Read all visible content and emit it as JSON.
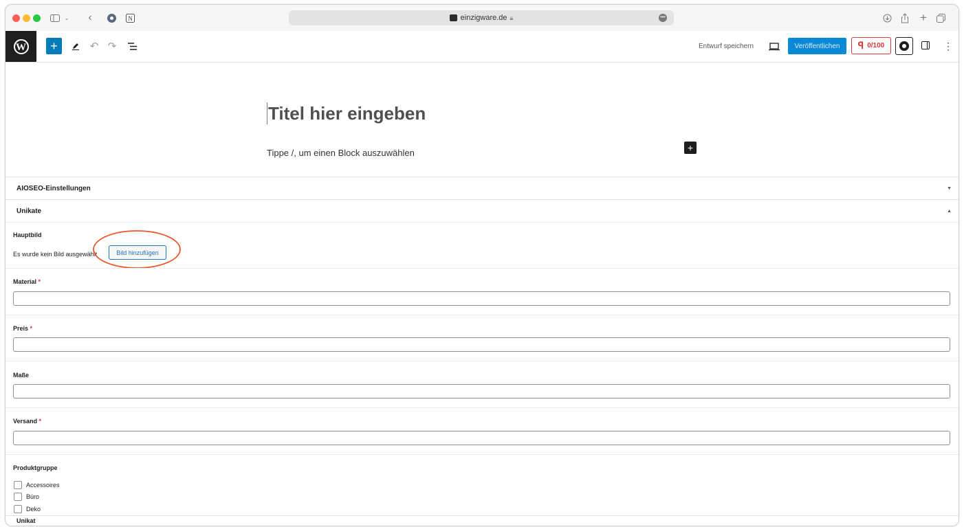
{
  "browser": {
    "url": "einzigware.de",
    "icons": [
      "sidebar-icon",
      "chevron-down-icon",
      "back-icon",
      "extension-icon",
      "notion-icon",
      "download-icon",
      "share-icon",
      "new-tab-icon",
      "tabs-icon"
    ]
  },
  "toolbar": {
    "add_label": "+",
    "save_draft_label": "Entwurf speichern",
    "publish_label": "Veröffentlichen",
    "seo_score": "0/100",
    "kebab_label": "⋮"
  },
  "editor": {
    "title_placeholder": "Titel hier eingeben",
    "block_hint": "Tippe /, um einen Block auszuwählen",
    "block_add_label": "+"
  },
  "metaboxes": {
    "aioseo": {
      "label": "AIOSEO-Einstellungen"
    },
    "unikate": {
      "label": "Unikate",
      "hauptbild": {
        "label": "Hauptbild",
        "empty_text": "Es wurde kein Bild ausgewählt",
        "button_label": "Bild hinzufügen"
      },
      "fields": {
        "material": {
          "label": "Material",
          "required_mark": "*"
        },
        "preis": {
          "label": "Preis",
          "required_mark": "*"
        },
        "masse": {
          "label": "Maße"
        },
        "versand": {
          "label": "Versand",
          "required_mark": "*"
        }
      },
      "produktgruppe": {
        "label": "Produktgruppe",
        "options": [
          "Accessoires",
          "Büro",
          "Deko"
        ]
      }
    },
    "unikat": {
      "label": "Unikat"
    }
  },
  "colors": {
    "accent": "#007cba",
    "publish": "#0a8ad6",
    "seo_red": "#d63638",
    "annotation": "#e8572a"
  }
}
